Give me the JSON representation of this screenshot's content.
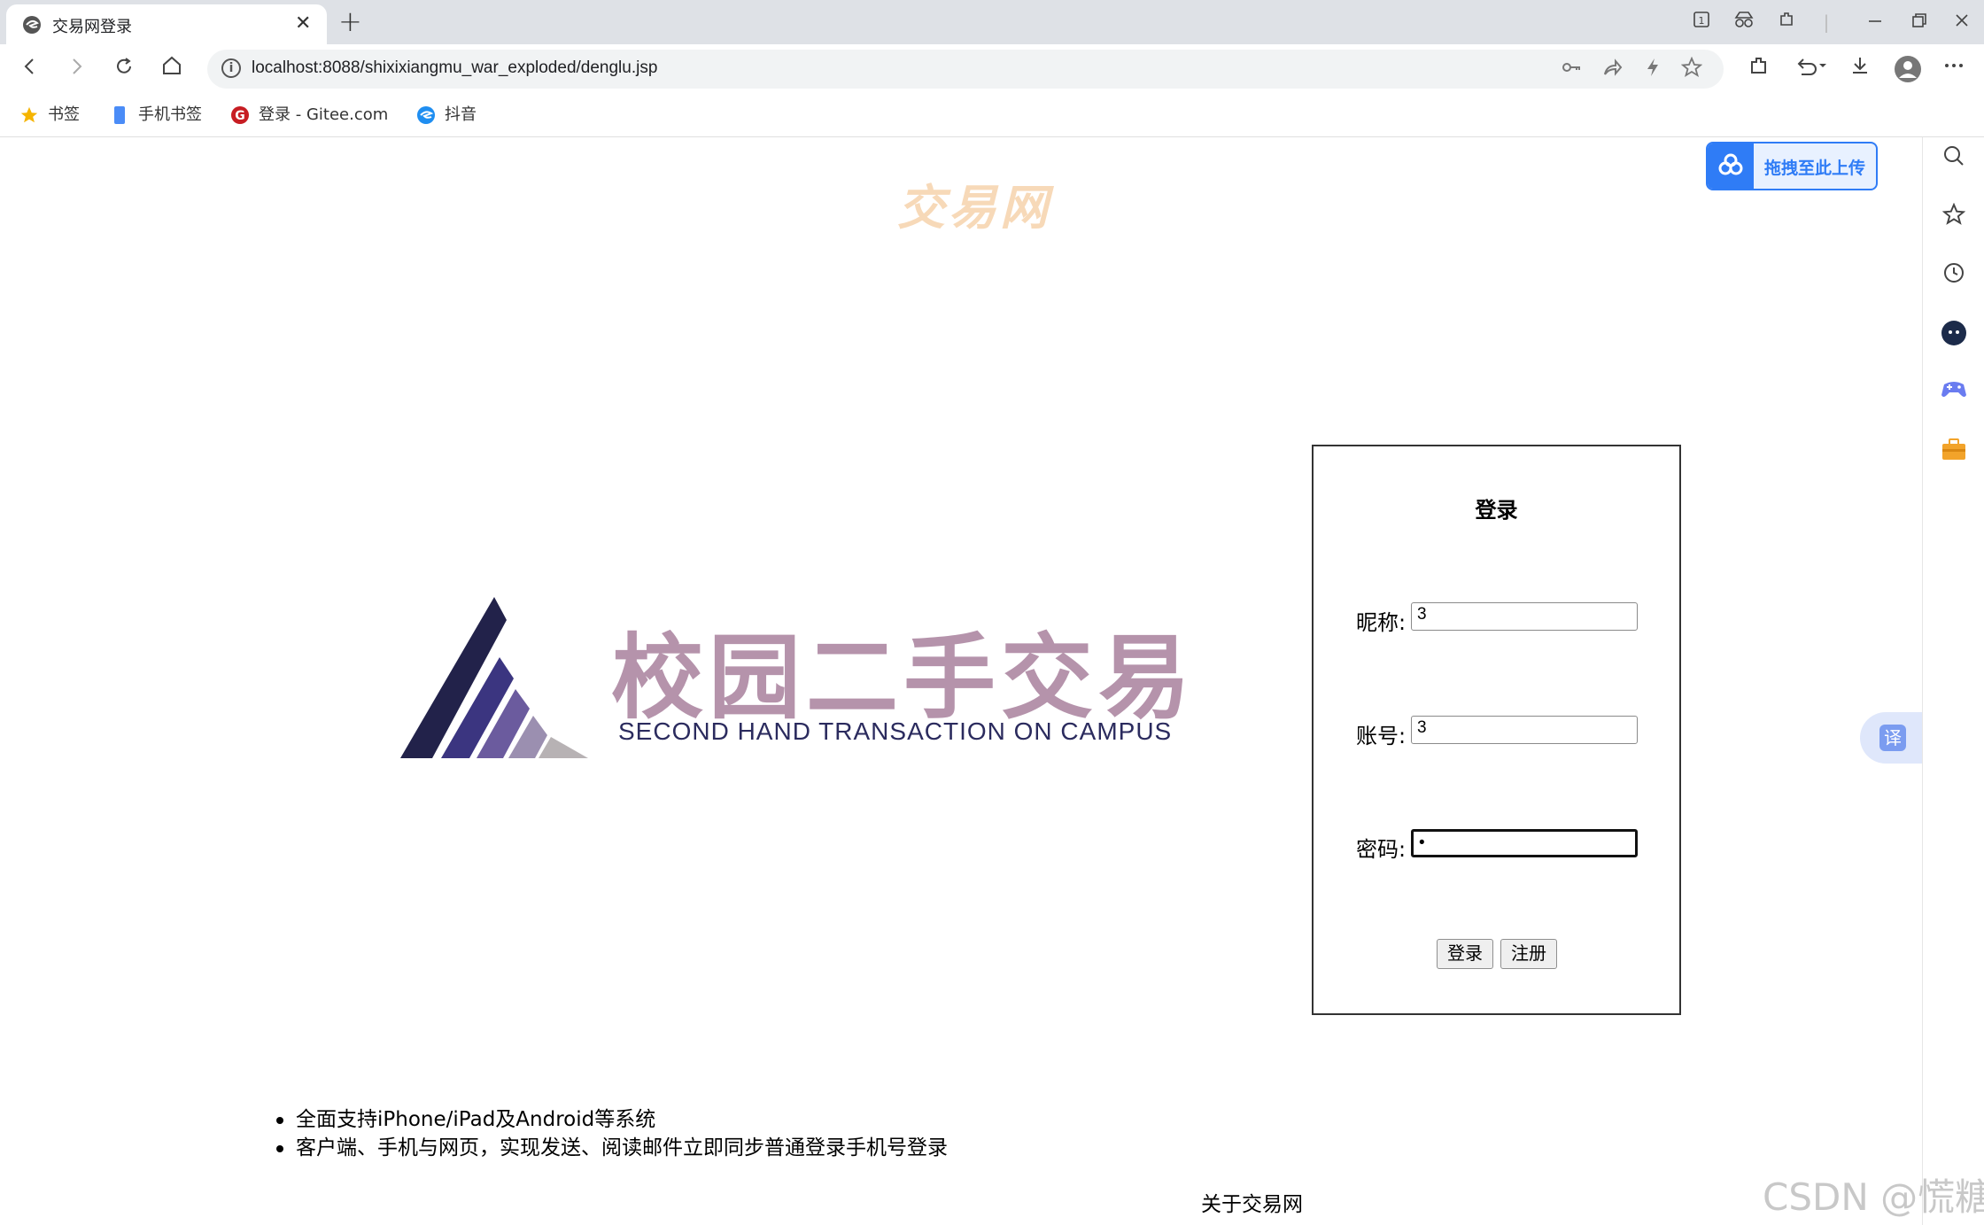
{
  "browser": {
    "tab_title": "交易网登录",
    "tab_close": "✕",
    "new_tab": "+",
    "url": "localhost:8088/shixixiangmu_war_exploded/denglu.jsp",
    "bookmarks": [
      {
        "label": "书签",
        "icon": "star-icon",
        "color": "#f5b400"
      },
      {
        "label": "手机书签",
        "icon": "phone-bookmark-icon",
        "color": "#4a8cf7"
      },
      {
        "label": "登录 - Gitee.com",
        "icon": "gitee-icon",
        "color": "#c71d23"
      },
      {
        "label": "抖音",
        "icon": "douyin-icon",
        "color": "#1f8ef1"
      }
    ]
  },
  "page": {
    "upload_label": "拖拽至此上传",
    "site_title": "交易网",
    "logo_cn": "校园二手交易",
    "logo_en": "SECOND HAND TRANSACTION ON CAMPUS",
    "login": {
      "title": "登录",
      "nickname_label": "昵称:",
      "nickname_value": "3",
      "account_label": "账号:",
      "account_value": "3",
      "password_label": "密码:",
      "password_value": "•",
      "login_button": "登录",
      "register_button": "注册"
    },
    "features": [
      "全面支持iPhone/iPad及Android等系统",
      "客户端、手机与网页，实现发送、阅读邮件立即同步普通登录手机号登录"
    ],
    "about": "关于交易网",
    "translate_label": "译",
    "watermark": "CSDN @慌糖"
  }
}
